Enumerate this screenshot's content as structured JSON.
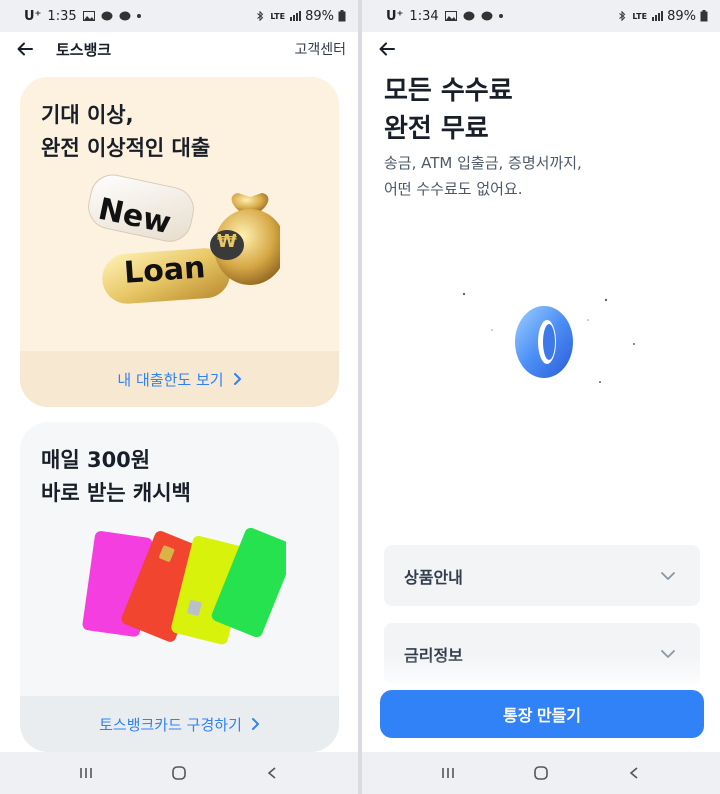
{
  "left_screen": {
    "status": {
      "carrier": "U⁺",
      "time": "1:35",
      "network": "LTE",
      "battery": "89%"
    },
    "app_bar": {
      "title": "토스뱅크",
      "help": "고객센터"
    },
    "loan_card": {
      "title_line1": "기대 이상,",
      "title_line2": "완전 이상적인 대출",
      "tag_new": "New",
      "tag_loan": "Loan",
      "coin_symbol": "₩",
      "link": "내 대출한도 보기"
    },
    "cashback_card": {
      "title_line1": "매일 300원",
      "title_line2": "바로 받는 캐시백",
      "card_colors": [
        "#f53ee0",
        "#f2452f",
        "#d9f20b",
        "#27e24f"
      ],
      "link": "토스뱅크카드 구경하기"
    }
  },
  "right_screen": {
    "status": {
      "carrier": "U⁺",
      "time": "1:34",
      "network": "LTE",
      "battery": "89%"
    },
    "headline_line1": "모든 수수료",
    "headline_line2": "완전 무료",
    "sub_line1": "송금, ATM 입출금, 증명서까지,",
    "sub_line2": "어떤 수수료도 없어요.",
    "zero_graphic": "0",
    "accordion": [
      "상품안내",
      "금리정보"
    ],
    "cta": "통장 만들기"
  },
  "colors": {
    "accent": "#3182f6",
    "loan_bg": "#fdf1df",
    "card_bg": "#f6f7f9",
    "text": "#191f28"
  },
  "icons": [
    "back-arrow-icon",
    "chevron-right-icon",
    "chevron-down-icon",
    "recent-apps-icon",
    "home-icon",
    "nav-back-icon"
  ]
}
